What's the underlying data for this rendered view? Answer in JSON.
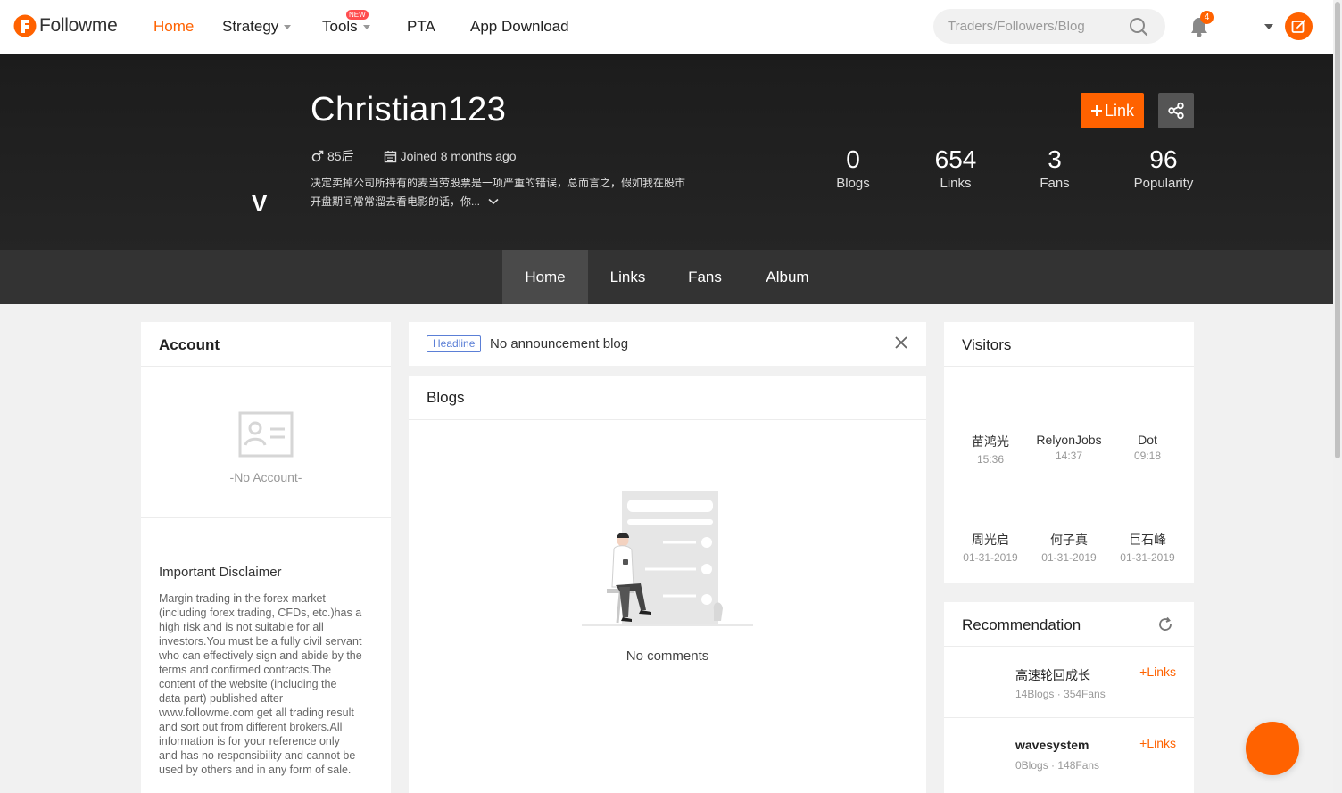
{
  "brand": {
    "name": "Followme",
    "accent": "#ff6200"
  },
  "nav": {
    "items": [
      {
        "label": "Home",
        "active": true
      },
      {
        "label": "Strategy",
        "dropdown": true
      },
      {
        "label": "Tools",
        "dropdown": true,
        "badge": "NEW"
      },
      {
        "label": "PTA"
      },
      {
        "label": "App Download"
      }
    ],
    "search_placeholder": "Traders/Followers/Blog",
    "notification_count": "4"
  },
  "profile": {
    "avatar_letter": "V",
    "username": "Christian123",
    "age_tag": "85后",
    "joined": "Joined 8 months ago",
    "bio_line1": "决定卖掉公司所持有的麦当劳股票是一项严重的错误，总而言之，假如我在股市",
    "bio_line2": "开盘期间常常溜去看电影的话，你...",
    "link_button": "Link",
    "stats": [
      {
        "value": "0",
        "label": "Blogs"
      },
      {
        "value": "654",
        "label": "Links"
      },
      {
        "value": "3",
        "label": "Fans"
      },
      {
        "value": "96",
        "label": "Popularity"
      }
    ]
  },
  "tabs": [
    {
      "label": "Home",
      "active": true
    },
    {
      "label": "Links"
    },
    {
      "label": "Fans"
    },
    {
      "label": "Album"
    }
  ],
  "account": {
    "title": "Account",
    "empty": "-No Account-",
    "disclaimer_title": "Important Disclaimer",
    "disclaimer_lines": [
      "Margin trading in the forex market",
      "(including forex trading, CFDs, etc.)has a",
      "high risk and is not suitable for all",
      "investors.You must be a fully civil servant",
      "who can effectively sign and abide by the",
      "terms and confirmed contracts.The",
      "content of the website (including the",
      "data part) published after",
      "www.followme.com get all trading result",
      "and sort out from different brokers.All",
      "information is for your reference only",
      "and has no responsibility and cannot be",
      "used by others and in any form of sale."
    ]
  },
  "headline": {
    "tag": "Headline",
    "text": "No announcement blog"
  },
  "blogs": {
    "title": "Blogs",
    "empty": "No comments"
  },
  "visitors": {
    "title": "Visitors",
    "list": [
      {
        "name": "苗鸿光",
        "time": "15:36"
      },
      {
        "name": "RelyonJobs",
        "time": "14:37"
      },
      {
        "name": "Dot",
        "time": "09:18"
      },
      {
        "name": "周光启",
        "time": "01-31-2019"
      },
      {
        "name": "何子真",
        "time": "01-31-2019"
      },
      {
        "name": "巨石峰",
        "time": "01-31-2019"
      }
    ]
  },
  "recommendation": {
    "title": "Recommendation",
    "items": [
      {
        "name": "高速轮回成长",
        "sub": "14Blogs · 354Fans",
        "action": "Links"
      },
      {
        "name": "wavesystem",
        "sub": "0Blogs · 148Fans",
        "action": "Links"
      }
    ]
  }
}
